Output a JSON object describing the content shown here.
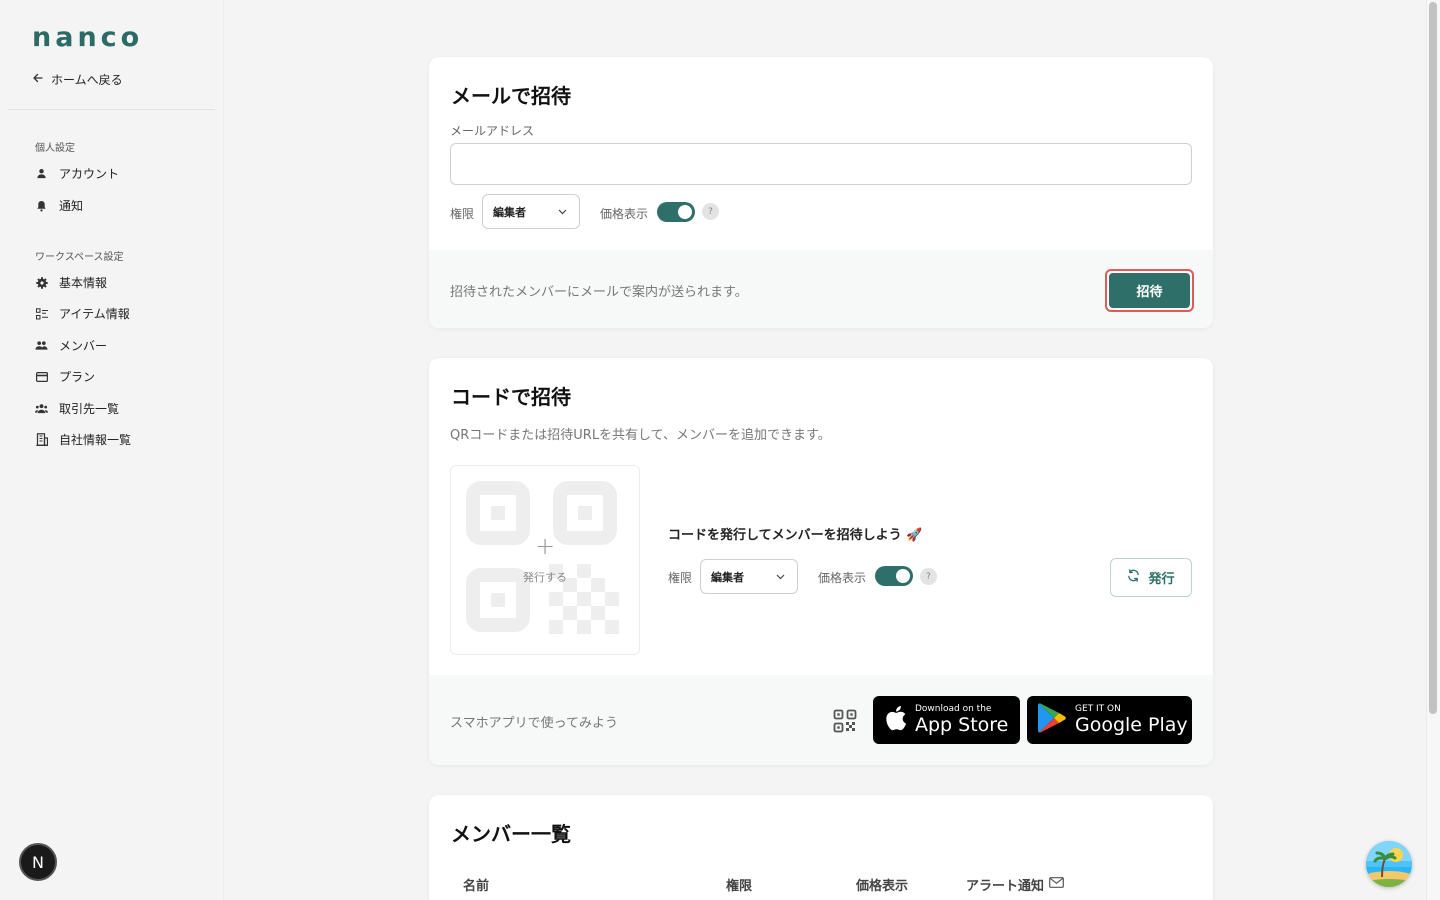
{
  "brand": {
    "logo": "nanco",
    "accent": "#2f6f69"
  },
  "sidebar": {
    "back_label": "ホームへ戻る",
    "personal_section": "個人設定",
    "personal_items": [
      {
        "label": "アカウント",
        "icon": "person-icon"
      },
      {
        "label": "通知",
        "icon": "bell-icon"
      }
    ],
    "workspace_section": "ワークスペース設定",
    "workspace_items": [
      {
        "label": "基本情報",
        "icon": "gear-icon"
      },
      {
        "label": "アイテム情報",
        "icon": "list-icon"
      },
      {
        "label": "メンバー",
        "icon": "members-icon"
      },
      {
        "label": "プラン",
        "icon": "card-icon"
      },
      {
        "label": "取引先一覧",
        "icon": "group-icon"
      },
      {
        "label": "自社情報一覧",
        "icon": "building-icon"
      }
    ],
    "avatar_letter": "N"
  },
  "email_invite": {
    "title": "メールで招待",
    "email_label": "メールアドレス",
    "email_value": "",
    "role_label": "権限",
    "role_value": "編集者",
    "price_label": "価格表示",
    "price_on": true,
    "help": "?",
    "note": "招待されたメンバーにメールで案内が送られます。",
    "invite_button": "招待"
  },
  "code_invite": {
    "title": "コードで招待",
    "description": "QRコードまたは招待URLを共有して、メンバーを追加できます。",
    "qr_plus": "+",
    "qr_label": "発行する",
    "headline": "コードを発行してメンバーを招待しよう 🚀",
    "role_label": "権限",
    "role_value": "編集者",
    "price_label": "価格表示",
    "price_on": true,
    "help": "?",
    "issue_button": "発行",
    "app_note": "スマホアプリで使ってみよう",
    "appstore_small": "Download on the",
    "appstore_big": "App Store",
    "googleplay_small": "GET IT ON",
    "googleplay_big": "Google Play"
  },
  "members": {
    "title": "メンバー一覧",
    "columns": [
      "名前",
      "権限",
      "価格表示",
      "アラート通知"
    ]
  }
}
